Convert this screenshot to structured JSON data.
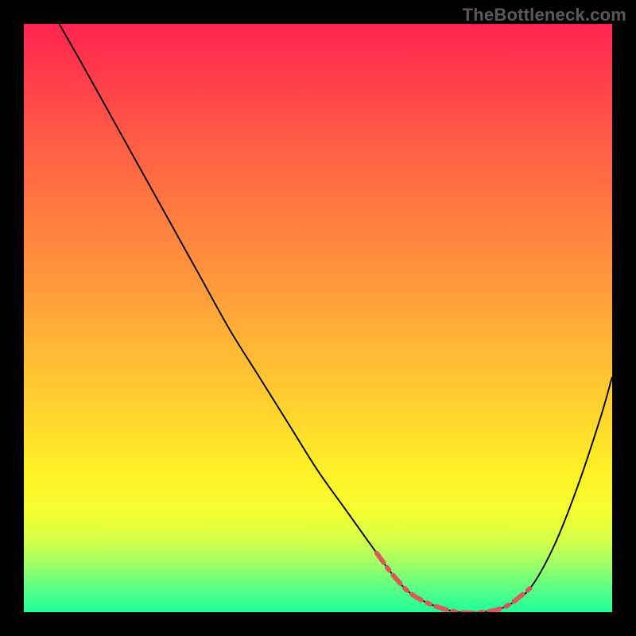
{
  "watermark": "TheBottleneck.com",
  "colors": {
    "background": "#000000",
    "curve": "#000000",
    "dashed_segment": "#d85a5a",
    "gradient_top": "#ff2550",
    "gradient_bottom": "#20ff9a"
  },
  "chart_data": {
    "type": "line",
    "title": "",
    "xlabel": "",
    "ylabel": "",
    "xlim": [
      0,
      100
    ],
    "ylim": [
      0,
      100
    ],
    "notes": "Single smooth curve on a red-to-green vertical gradient. Y is a mismatch/energy axis: high at left, dipping to near-zero around x≈70-80, then rising again. A dashed coral segment marks the flat trough region. Numeric values interpolated from the visible shape; no axis ticks shown.",
    "series": [
      {
        "name": "curve",
        "x": [
          6,
          10,
          15,
          20,
          25,
          30,
          35,
          40,
          45,
          50,
          55,
          60,
          63,
          66,
          70,
          74,
          78,
          82,
          86,
          90,
          94,
          98,
          100
        ],
        "y": [
          100,
          93,
          84,
          75,
          66,
          57,
          48,
          40,
          32,
          24,
          17,
          10,
          6,
          3,
          1,
          0,
          0,
          1,
          4,
          11,
          21,
          33,
          40
        ]
      }
    ],
    "highlight_region": {
      "name": "trough-dashed",
      "x_start": 63,
      "x_end": 82,
      "y_approx": 1
    }
  }
}
